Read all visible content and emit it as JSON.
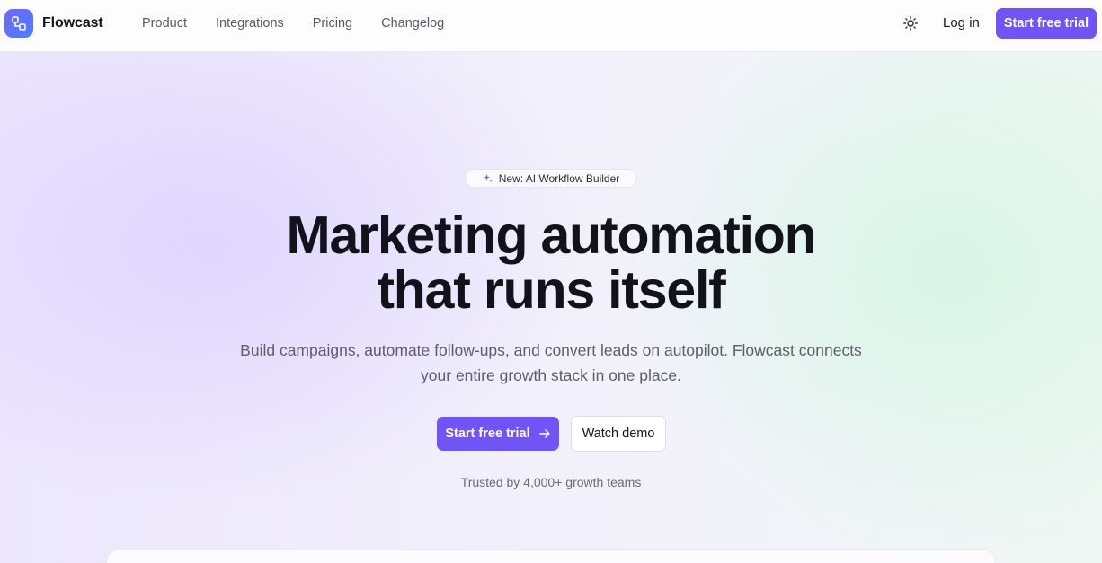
{
  "nav": {
    "brand": "Flowcast",
    "links": [
      "Product",
      "Integrations",
      "Pricing",
      "Changelog"
    ],
    "login": "Log in",
    "cta": "Start free trial"
  },
  "hero": {
    "badge": "New: AI Workflow Builder",
    "headline_line1": "Marketing automation",
    "headline_line2": "that runs itself",
    "subtext": "Build campaigns, automate follow-ups, and convert leads on autopilot. Flowcast connects your entire growth stack in one place.",
    "cta_primary": "Start free trial",
    "cta_secondary": "Watch demo",
    "trusted": "Trusted by 4,000+ growth teams"
  },
  "icons": {
    "logo": "workflow-icon",
    "theme": "sun-icon",
    "badge": "sparkles-icon",
    "cta_arrow": "arrow-right-icon"
  },
  "colors": {
    "accent": "#7054f5",
    "logo": "#5b72ff",
    "text": "#12121a"
  }
}
